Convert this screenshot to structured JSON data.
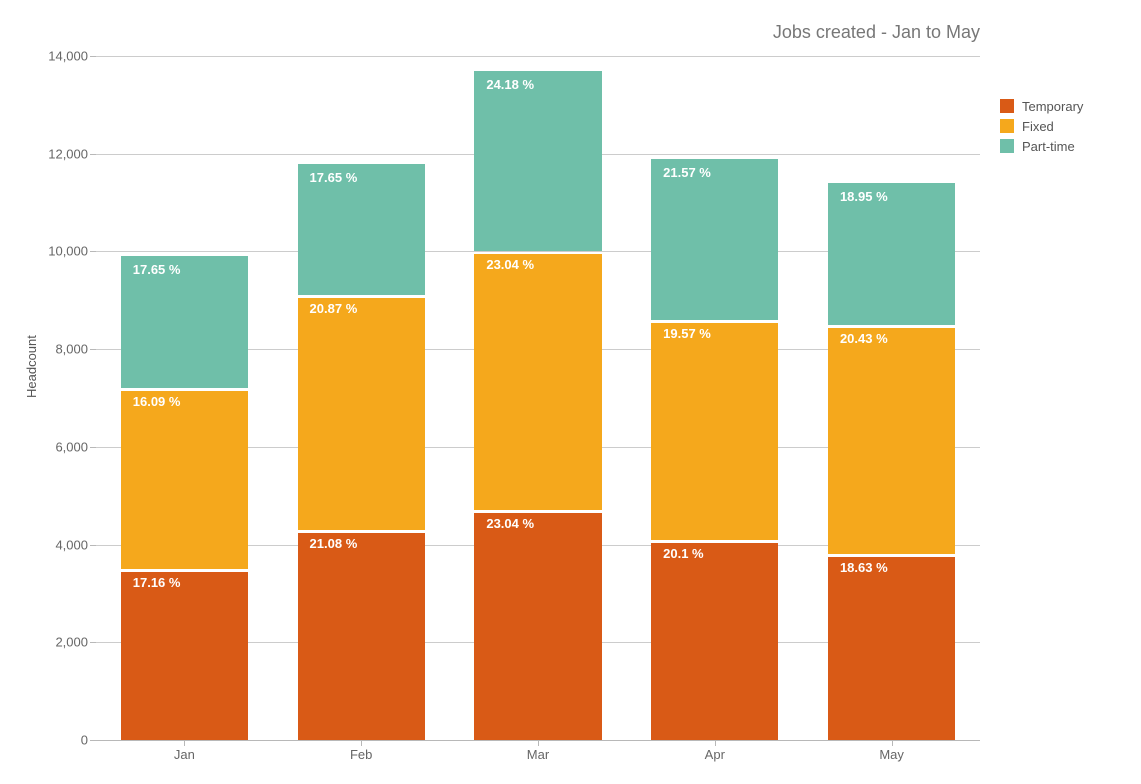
{
  "chart_data": {
    "type": "bar",
    "stacked": true,
    "title": "Jobs created - Jan to May",
    "xlabel": "",
    "ylabel": "Headcount",
    "ylim": [
      0,
      14000
    ],
    "y_ticks": [
      0,
      2000,
      4000,
      6000,
      8000,
      10000,
      12000,
      14000
    ],
    "y_tick_labels": [
      "0",
      "2,000",
      "4,000",
      "6,000",
      "8,000",
      "10,000",
      "12,000",
      "14,000"
    ],
    "categories": [
      "Jan",
      "Feb",
      "Mar",
      "Apr",
      "May"
    ],
    "series": [
      {
        "name": "Temporary",
        "values": [
          3500,
          4300,
          4700,
          4100,
          3800
        ]
      },
      {
        "name": "Fixed",
        "values": [
          3700,
          4800,
          5300,
          4500,
          4700
        ]
      },
      {
        "name": "Part-time",
        "values": [
          2700,
          2700,
          3700,
          3300,
          2900
        ]
      }
    ],
    "segment_labels_pct": {
      "Temporary": [
        "17.16 %",
        "21.08 %",
        "23.04 %",
        "20.1 %",
        "18.63 %"
      ],
      "Fixed": [
        "16.09 %",
        "20.87 %",
        "23.04 %",
        "19.57 %",
        "20.43 %"
      ],
      "Part-time": [
        "17.65 %",
        "17.65 %",
        "24.18 %",
        "21.57 %",
        "18.95 %"
      ]
    },
    "colors": {
      "Temporary": "#d95a16",
      "Fixed": "#f5a81c",
      "Part-time": "#6fbfa9"
    },
    "legend_position": "right"
  }
}
